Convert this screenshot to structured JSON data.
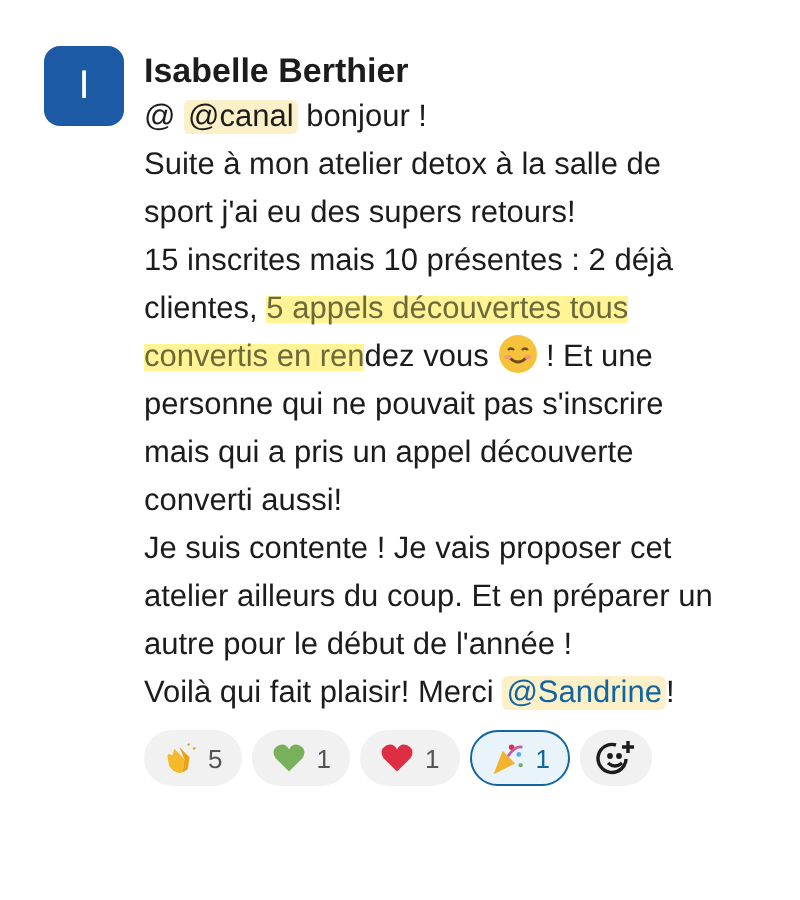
{
  "message": {
    "author": "Isabelle Berthier",
    "avatar_letter": "I",
    "paragraphs": [
      [
        {
          "kind": "text",
          "text": "@ "
        },
        {
          "kind": "broadcast",
          "text": "@canal"
        },
        {
          "kind": "text",
          "text": " bonjour !"
        }
      ],
      [
        {
          "kind": "text",
          "text": "Suite à mon atelier detox à la salle de sport j'ai eu des supers retours!"
        }
      ],
      [
        {
          "kind": "text",
          "text": "15 inscrites mais 10 présentes : 2 déjà clientes, "
        },
        {
          "kind": "highlight",
          "text": "5 appels découvertes tous convertis en ren"
        },
        {
          "kind": "text",
          "text": "dez vous "
        },
        {
          "kind": "emoji"
        },
        {
          "kind": "text",
          "text": " ! Et une personne qui ne pouvait pas s'inscrire mais qui a pris un appel découverte converti aussi!"
        }
      ],
      [
        {
          "kind": "text",
          "text": "Je suis contente ! Je vais proposer cet atelier ailleurs du coup. Et en préparer un autre pour le début de l'année !"
        }
      ],
      [
        {
          "kind": "text",
          "text": "Voilà qui fait plaisir! Merci "
        },
        {
          "kind": "mention",
          "text": "@Sandrine"
        },
        {
          "kind": "text",
          "text": "!"
        }
      ]
    ]
  },
  "reactions": [
    {
      "kind": "clap",
      "count": "5",
      "selected": false
    },
    {
      "kind": "green-heart",
      "count": "1",
      "selected": false
    },
    {
      "kind": "red-heart",
      "count": "1",
      "selected": false
    },
    {
      "kind": "party",
      "count": "1",
      "selected": true
    }
  ]
}
